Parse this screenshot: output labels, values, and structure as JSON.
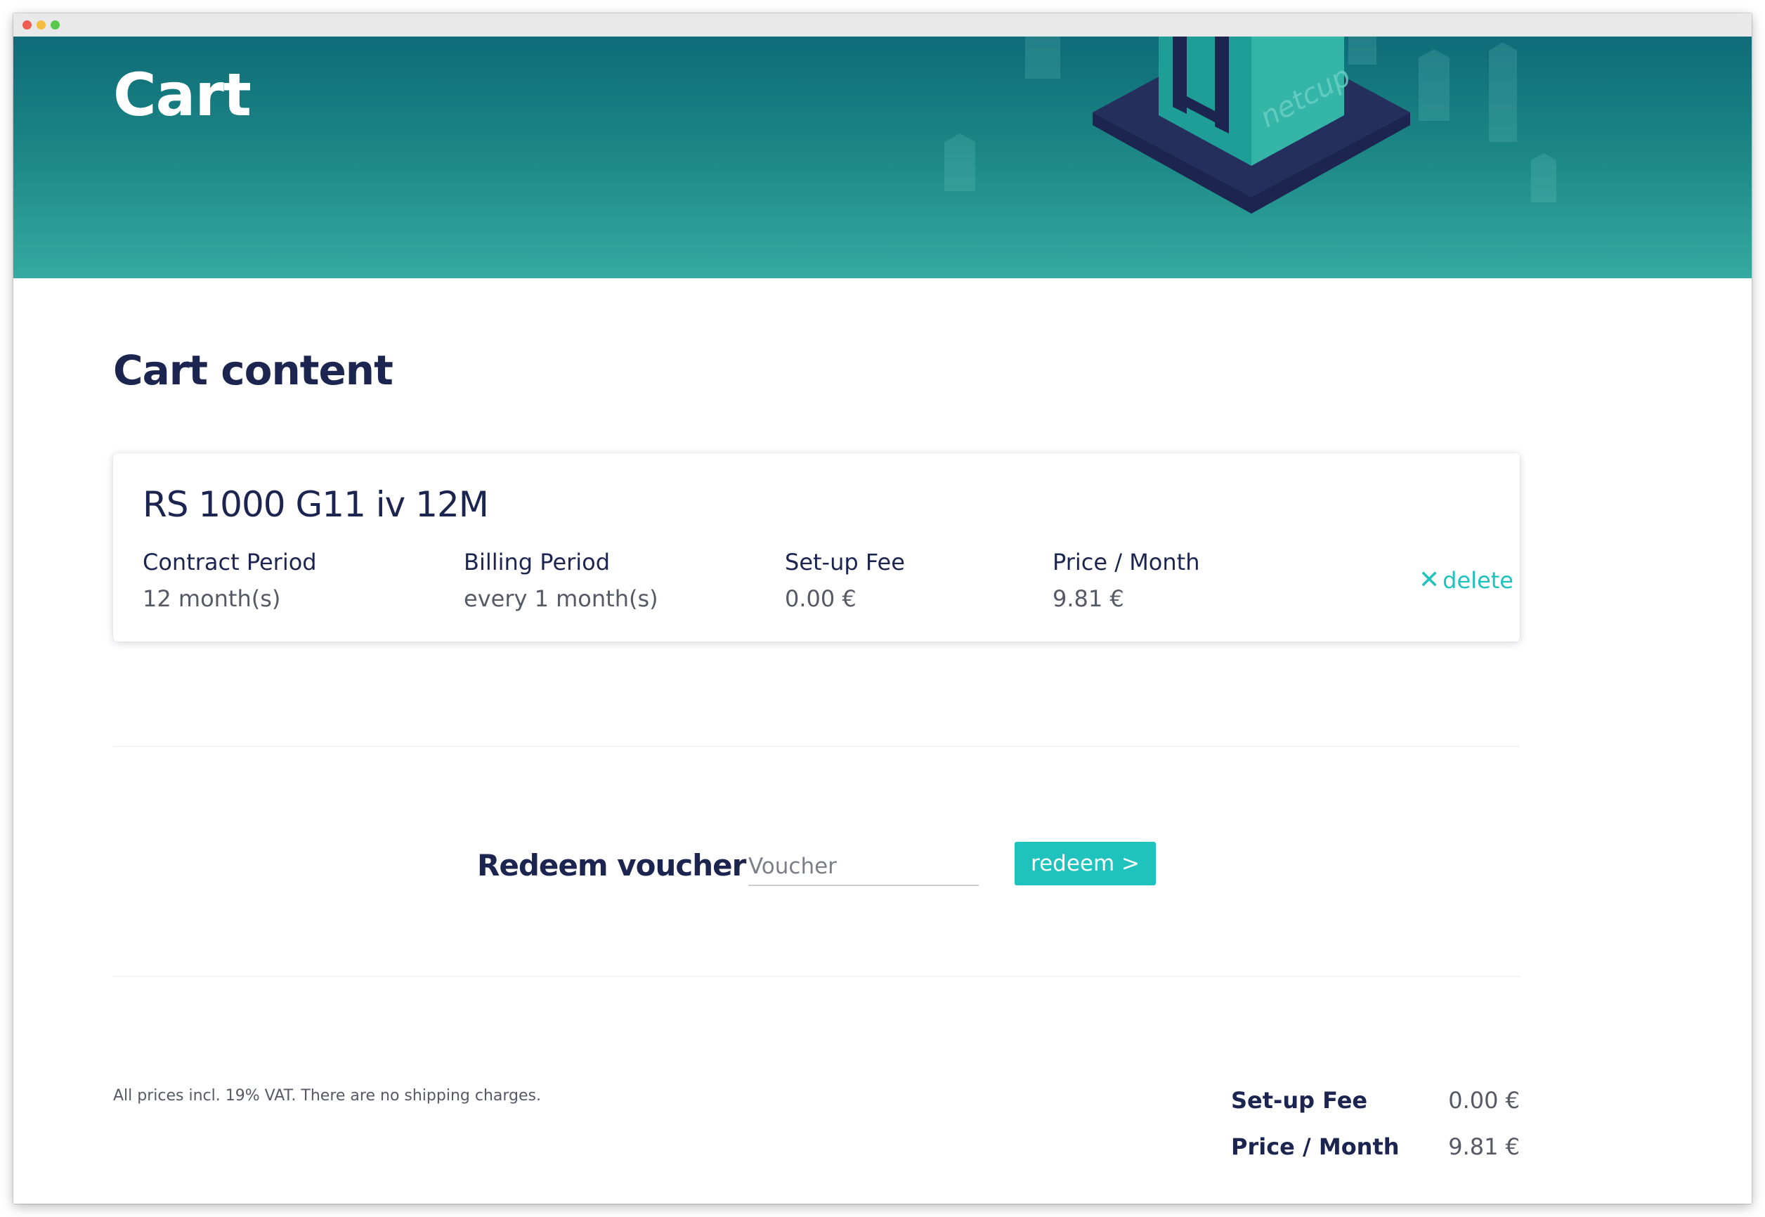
{
  "header": {
    "title": "Cart",
    "brand_watermark": "netcup"
  },
  "cart": {
    "title": "Cart content",
    "items": [
      {
        "name": "RS 1000 G11 iv 12M",
        "contract_period_label": "Contract Period",
        "contract_period_value": "12 month(s)",
        "billing_period_label": "Billing Period",
        "billing_period_value": "every 1 month(s)",
        "setup_fee_label": "Set-up Fee",
        "setup_fee_value": "0.00 €",
        "price_month_label": "Price / Month",
        "price_month_value": "9.81 €",
        "delete_icon": "✕",
        "delete_label": "delete"
      }
    ]
  },
  "voucher": {
    "title": "Redeem voucher",
    "placeholder": "Voucher",
    "value": "",
    "button_label": "redeem >"
  },
  "footer": {
    "vat_note": "All prices incl. 19% VAT. There are no shipping charges.",
    "summary": [
      {
        "label": "Set-up Fee",
        "value": "0.00 €"
      },
      {
        "label": "Price / Month",
        "value": "9.81 €"
      }
    ]
  },
  "colors": {
    "accent": "#1fc2bd",
    "navy": "#1b2550",
    "hero_top": "#0f6b78",
    "hero_bottom": "#34aaa0"
  }
}
